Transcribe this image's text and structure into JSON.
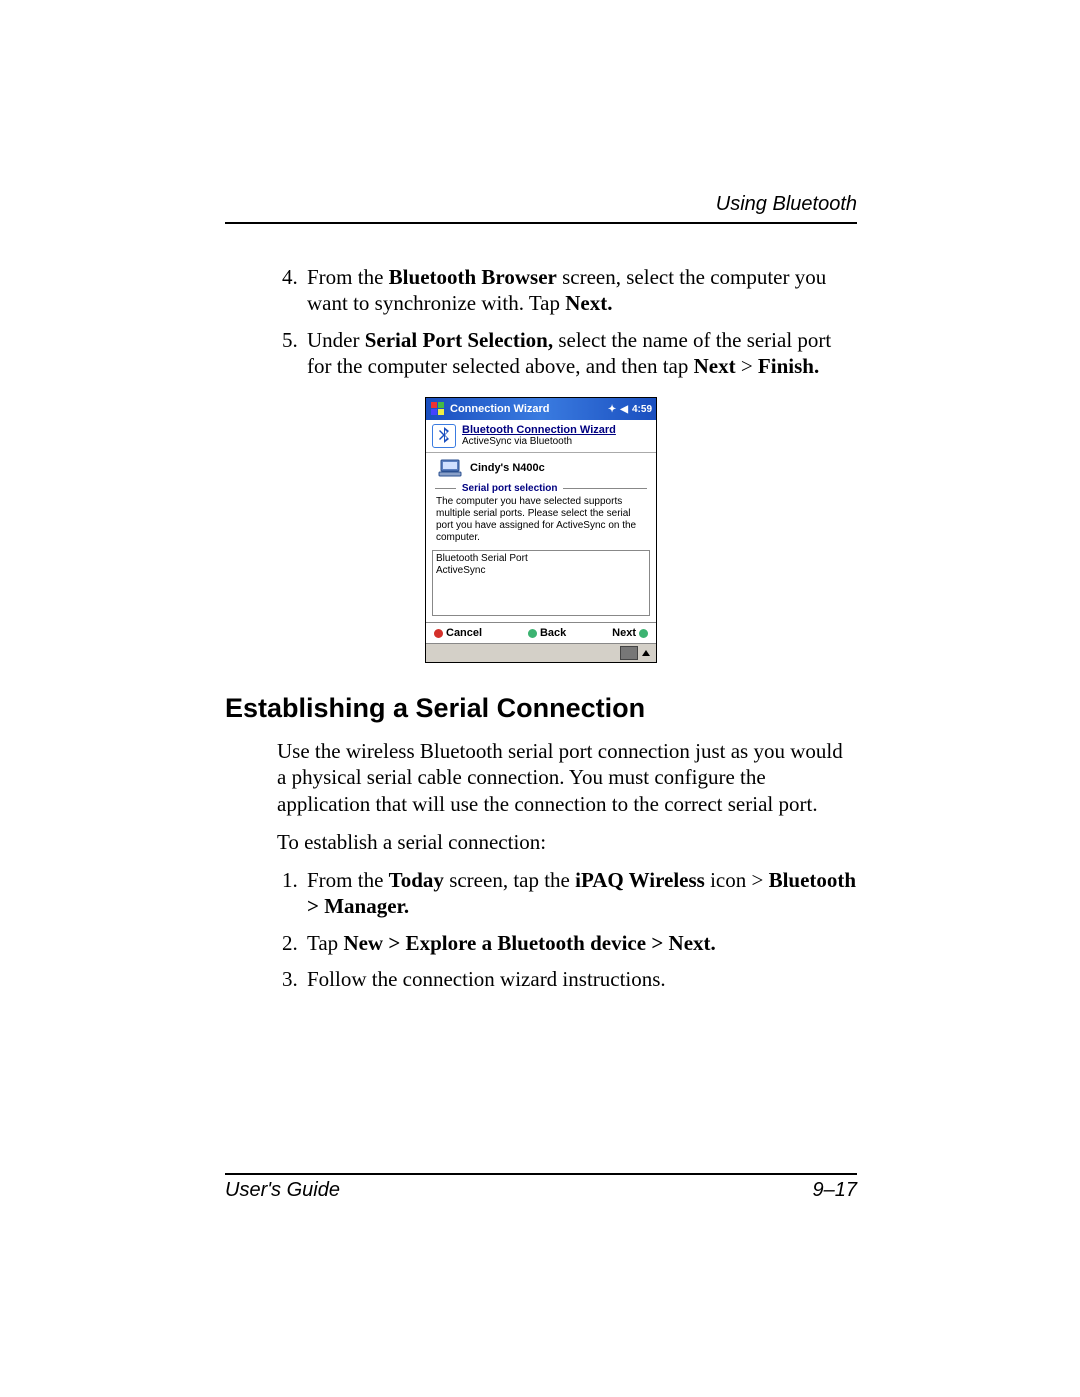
{
  "header": {
    "section": "Using Bluetooth"
  },
  "steps_continued": {
    "start": 4,
    "items": [
      {
        "pre": "From the ",
        "b1": "Bluetooth Browser",
        "mid": " screen, select the computer you want to synchronize with. Tap ",
        "b2": "Next.",
        "post": ""
      },
      {
        "pre": "Under ",
        "b1": "Serial Port Selection,",
        "mid": " select the name of the serial port for the computer selected above, and then tap ",
        "b2": "Next",
        "post": " > ",
        "b3": "Finish."
      }
    ]
  },
  "wizard": {
    "titlebar": "Connection Wizard",
    "time": "4:59",
    "header_title": "Bluetooth Connection Wizard",
    "header_sub": "ActiveSync via Bluetooth",
    "computer_name": "Cindy's N400c",
    "legend": "Serial port selection",
    "help_text": "The computer you have selected supports multiple serial ports. Please select the serial port you have assigned for ActiveSync on the computer.",
    "list_items": [
      "Bluetooth Serial Port",
      "ActiveSync"
    ],
    "btn_cancel": "Cancel",
    "btn_back": "Back",
    "btn_next": "Next"
  },
  "section2": {
    "heading": "Establishing a Serial Connection",
    "para1": "Use the wireless Bluetooth serial port connection just as you would a physical serial cable connection. You must configure the application that will use the connection to the correct serial port.",
    "para2": "To establish a serial connection:",
    "steps": [
      {
        "pre": "From the ",
        "b1": "Today",
        "mid": " screen, tap the ",
        "b2": "iPAQ Wireless",
        "mid2": " icon > ",
        "b3": "Bluetooth > Manager."
      },
      {
        "pre": "Tap ",
        "b1": "New > Explore a Bluetooth device > Next."
      },
      {
        "pre": "Follow the connection wizard instructions."
      }
    ]
  },
  "footer": {
    "left": "User's Guide",
    "right": "9–17"
  }
}
